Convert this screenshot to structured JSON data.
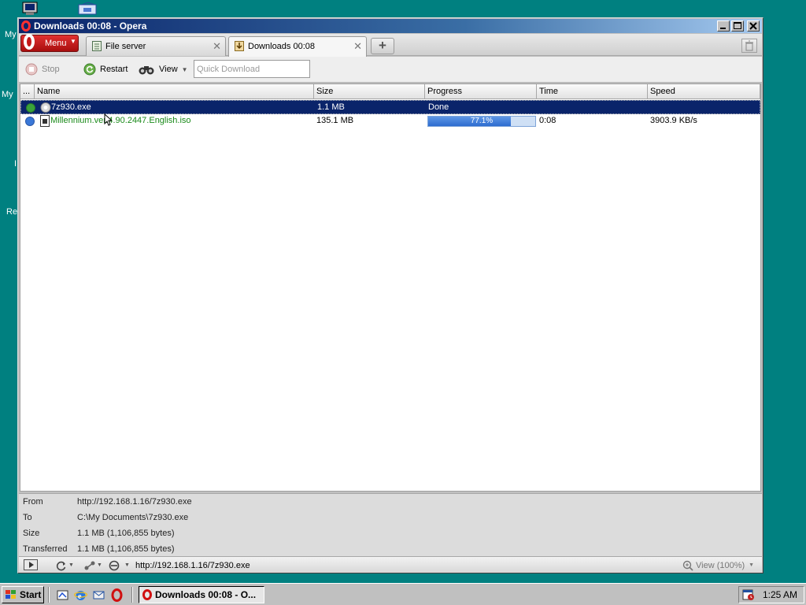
{
  "desktop": {
    "labels": [
      "My",
      "My",
      "I",
      "Re"
    ]
  },
  "window": {
    "title": "Downloads 00:08 - Opera",
    "menu_label": "Menu",
    "tabs": [
      {
        "label": "File server",
        "active": false
      },
      {
        "label": "Downloads 00:08",
        "active": true
      }
    ]
  },
  "toolbar": {
    "stop_label": "Stop",
    "restart_label": "Restart",
    "view_label": "View",
    "quick_download_placeholder": "Quick Download"
  },
  "list": {
    "columns": [
      "...",
      "Name",
      "Size",
      "Progress",
      "Time",
      "Speed"
    ],
    "rows": [
      {
        "name": "7z930.exe",
        "size": "1.1 MB",
        "progress_text": "Done",
        "time": "",
        "speed": "",
        "status": "done",
        "selected": true
      },
      {
        "name": "Millennium.ver.4.90.2447.English.iso",
        "size": "135.1 MB",
        "progress_text": "77.1%",
        "progress_fraction": 0.771,
        "time": "0:08",
        "speed": "3903.9 KB/s",
        "status": "downloading",
        "selected": false
      }
    ]
  },
  "details": {
    "from_label": "From",
    "from_value": "http://192.168.1.16/7z930.exe",
    "to_label": "To",
    "to_value": "C:\\My Documents\\7z930.exe",
    "size_label": "Size",
    "size_value": "1.1 MB (1,106,855 bytes)",
    "transferred_label": "Transferred",
    "transferred_value": "1.1 MB (1,106,855 bytes)"
  },
  "statusbar": {
    "url": "http://192.168.1.16/7z930.exe",
    "zoom": "View (100%)"
  },
  "taskbar": {
    "start_label": "Start",
    "task_label": "Downloads 00:08 - O...",
    "clock": "1:25 AM"
  },
  "colors": {
    "desktop": "#008080",
    "selection": "#0a246a",
    "progress_fill": "#2d6cd0",
    "downloading_text": "#1a8a1a"
  }
}
